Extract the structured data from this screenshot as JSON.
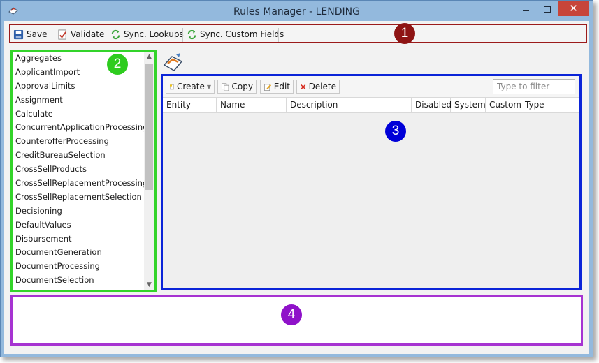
{
  "window": {
    "title": "Rules Manager - LENDING",
    "close_glyph": "✕"
  },
  "toolbar": {
    "buttons": [
      {
        "label": "Save",
        "icon": "save-icon"
      },
      {
        "label": "Validate",
        "icon": "validate-icon"
      },
      {
        "label": "Sync. Lookups",
        "icon": "sync-icon"
      },
      {
        "label": "Sync. Custom Fields",
        "icon": "sync-icon"
      }
    ]
  },
  "callouts": [
    "1",
    "2",
    "3",
    "4"
  ],
  "rules": {
    "items": [
      "Aggregates",
      "ApplicantImport",
      "ApprovalLimits",
      "Assignment",
      "Calculate",
      "ConcurrentApplicationProcessing",
      "CounterofferProcessing",
      "CreditBureauSelection",
      "CrossSellProducts",
      "CrossSellReplacementProcessing",
      "CrossSellReplacementSelection",
      "Decisioning",
      "DefaultValues",
      "Disbursement",
      "DocumentGeneration",
      "DocumentProcessing",
      "DocumentSelection"
    ]
  },
  "grid": {
    "actions": [
      {
        "label": "Create",
        "icon": "create-icon",
        "has_dropdown": true
      },
      {
        "label": "Copy",
        "icon": "copy-icon"
      },
      {
        "label": "Edit",
        "icon": "edit-icon"
      },
      {
        "label": "Delete",
        "icon": "delete-icon"
      }
    ],
    "filter_placeholder": "Type to filter",
    "columns": [
      "Entity",
      "Name",
      "Description",
      "Disabled",
      "System",
      "Custom",
      "Type"
    ]
  },
  "colors": {
    "toolbar_border": "#9b1b1b",
    "list_border": "#33d42a",
    "grid_border": "#0b24d8",
    "details_border": "#a633d1",
    "title_bar": "#93b9dd",
    "close_button": "#c7453a"
  }
}
